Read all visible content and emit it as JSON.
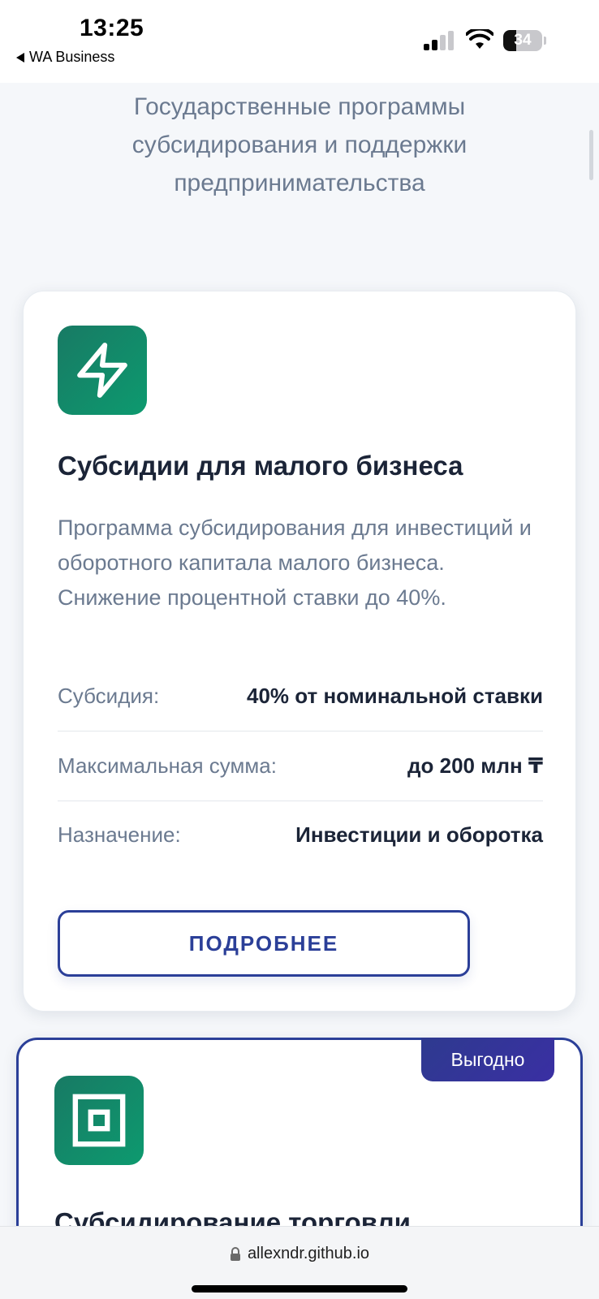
{
  "status_bar": {
    "time": "13:25",
    "back_app": "WA Business",
    "battery": "34",
    "battery_fraction": 0.34
  },
  "page": {
    "subtitle": "Государственные программы субсидирования и поддержки предпринимательства"
  },
  "cards": [
    {
      "icon": "lightning-icon",
      "title": "Субсидии для малого бизнеса",
      "description": "Программа субсидирования для инвестиций и оборотного капитала малого бизнеса. Снижение процентной ставки до 40%.",
      "rows": [
        {
          "label": "Субсидия:",
          "value": "40% от номинальной ставки"
        },
        {
          "label": "Максимальная сумма:",
          "value": "до 200 млн ₸"
        },
        {
          "label": "Назначение:",
          "value": "Инвестиции и оборотка"
        }
      ],
      "button": "ПОДРОБНЕЕ"
    },
    {
      "icon": "square-target-icon",
      "badge": "Выгодно",
      "title": "Субсидирование торговли"
    }
  ],
  "browser": {
    "url": "allexndr.github.io"
  },
  "colors": {
    "accent": "#2b3f98",
    "icon_green": "#0d9a6f",
    "text_dark": "#1b2437",
    "text_muted": "#6b7a90"
  }
}
